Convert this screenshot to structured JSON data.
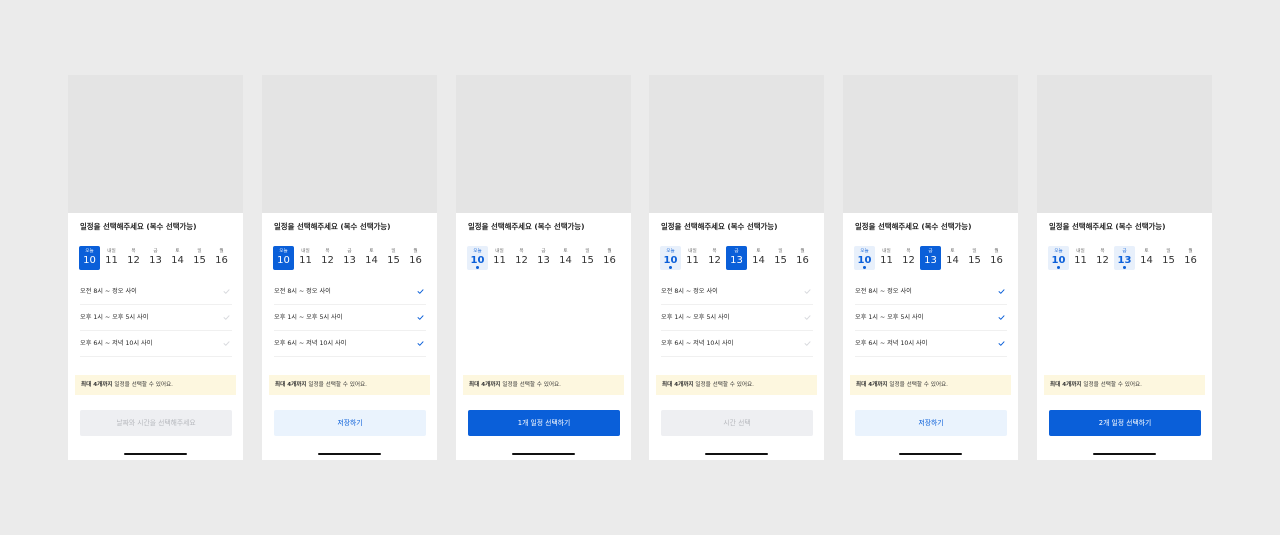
{
  "title": "일정을 선택해주세요 (복수 선택가능)",
  "day_labels": [
    "오늘",
    "내일",
    "목",
    "금",
    "토",
    "일",
    "월"
  ],
  "day_numbers": [
    "10",
    "11",
    "12",
    "13",
    "14",
    "15",
    "16"
  ],
  "slots": [
    "오전 8시 ~ 정오 사이",
    "오후 1시 ~ 오후 5시 사이",
    "오후 6시 ~ 저녁 10시 사이"
  ],
  "notice_bold": "최대 4개까지",
  "notice_rest": " 일정을 선택할 수 있어요.",
  "colors": {
    "accent": "#0a5fd9",
    "accent_light": "#e8f0fb",
    "notice_bg": "#fdf7df",
    "check_active": "#0a5fd9",
    "check_inactive": "#d7d9dd"
  },
  "screens": [
    {
      "cta_label": "날짜와 시간을 선택해주세요",
      "cta_style": "disabled"
    },
    {
      "cta_label": "저장하기",
      "cta_style": "light"
    },
    {
      "cta_label": "1개 일정 선택하기",
      "cta_style": "primary"
    },
    {
      "cta_label": "시간 선택",
      "cta_style": "disabled"
    },
    {
      "cta_label": "저장하기",
      "cta_style": "light"
    },
    {
      "cta_label": "2개 일정 선택하기",
      "cta_style": "primary"
    }
  ]
}
